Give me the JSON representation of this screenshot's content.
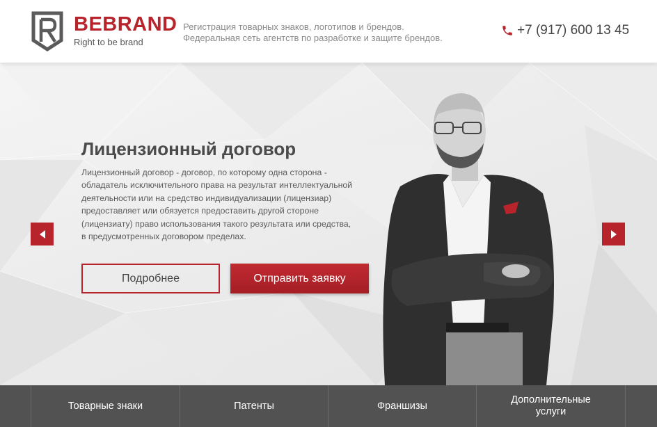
{
  "header": {
    "brand_name": "BEBRAND",
    "brand_slogan": "Right to be brand",
    "tagline_line1": "Регистрация товарных знаков, логотипов и брендов.",
    "tagline_line2": "Федеральная сеть агентств по разработке и защите брендов.",
    "phone": "+7 (917) 600 13 45"
  },
  "hero": {
    "title": "Лицензионный договор",
    "description": "Лицензионный договор - договор, по которому одна сторона - обладатель исключительного права на результат интеллектуальной деятельности или на средство индивидуализации (лицензиар) предоставляет или обязуется предоставить другой стороне (лицензиату) право использования такого результата или средства, в предусмотренных договором пределах.",
    "more_button": "Подробнее",
    "submit_button": "Отправить заявку"
  },
  "nav": {
    "items": [
      {
        "label": "Товарные знаки"
      },
      {
        "label": "Патенты"
      },
      {
        "label": "Франшизы"
      },
      {
        "label": "Дополнительные услуги"
      }
    ]
  },
  "icons": {
    "logo": "shield-r-icon",
    "phone": "phone-icon",
    "prev": "chevron-left-icon",
    "next": "chevron-right-icon"
  },
  "colors": {
    "accent": "#b8242b",
    "nav_bg": "#525252",
    "text_dark": "#4b4b4b"
  }
}
